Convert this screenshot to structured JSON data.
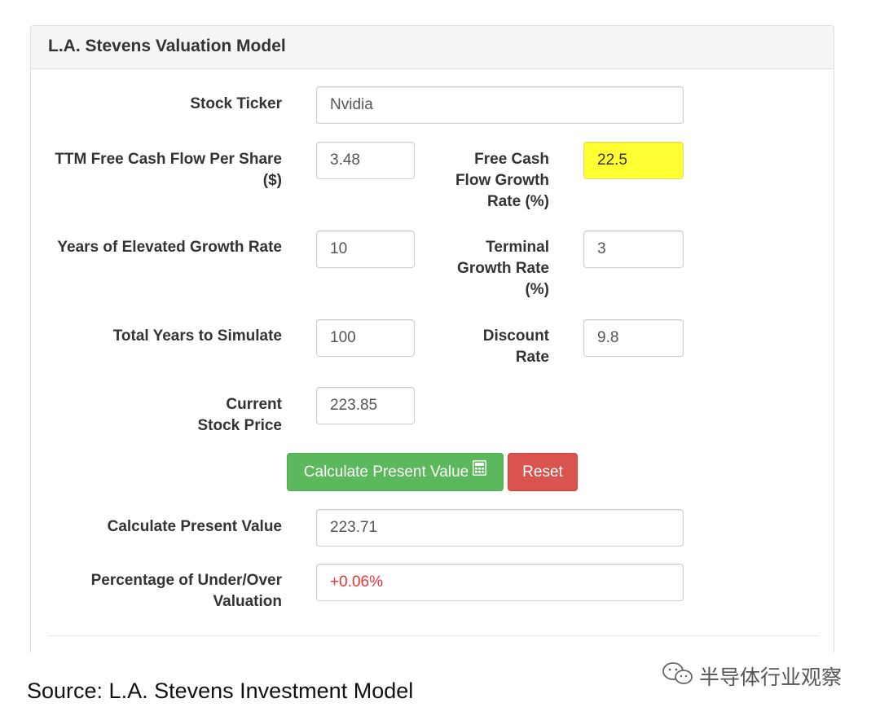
{
  "panel": {
    "title": "L.A. Stevens Valuation Model"
  },
  "form": {
    "ticker": {
      "label": "Stock Ticker",
      "value": "Nvidia"
    },
    "ttm_fcf": {
      "label_line1": "TTM Free Cash Flow Per Share",
      "label_line2": "($)",
      "value": "3.48"
    },
    "fcf_growth": {
      "label_line1": "Free Cash",
      "label_line2": "Flow Growth",
      "label_line3": "Rate (%)",
      "value": "22.5"
    },
    "years_elevated": {
      "label": "Years of Elevated Growth Rate",
      "value": "10"
    },
    "terminal_growth": {
      "label_line1": "Terminal",
      "label_line2": "Growth Rate",
      "label_line3": "(%)",
      "value": "3"
    },
    "total_years": {
      "label": "Total Years to Simulate",
      "value": "100"
    },
    "discount_rate": {
      "label_line1": "Discount",
      "label_line2": "Rate",
      "value": "9.8"
    },
    "current_price": {
      "label_line1": "Current",
      "label_line2": "Stock Price",
      "value": "223.85"
    }
  },
  "buttons": {
    "calculate": "Calculate Present Value",
    "reset": "Reset"
  },
  "results": {
    "present_value": {
      "label": "Calculate Present Value",
      "value": "223.71"
    },
    "percentage": {
      "label_line1": "Percentage of Under/Over",
      "label_line2": "Valuation",
      "value": "+0.06%"
    }
  },
  "footer": {
    "source": "Source: L.A. Stevens Investment Model",
    "watermark": "半导体行业观察"
  },
  "colors": {
    "highlight": "#ffff33",
    "success": "#5cb85c",
    "danger": "#d9534f",
    "negative_text": "#e8343a"
  }
}
